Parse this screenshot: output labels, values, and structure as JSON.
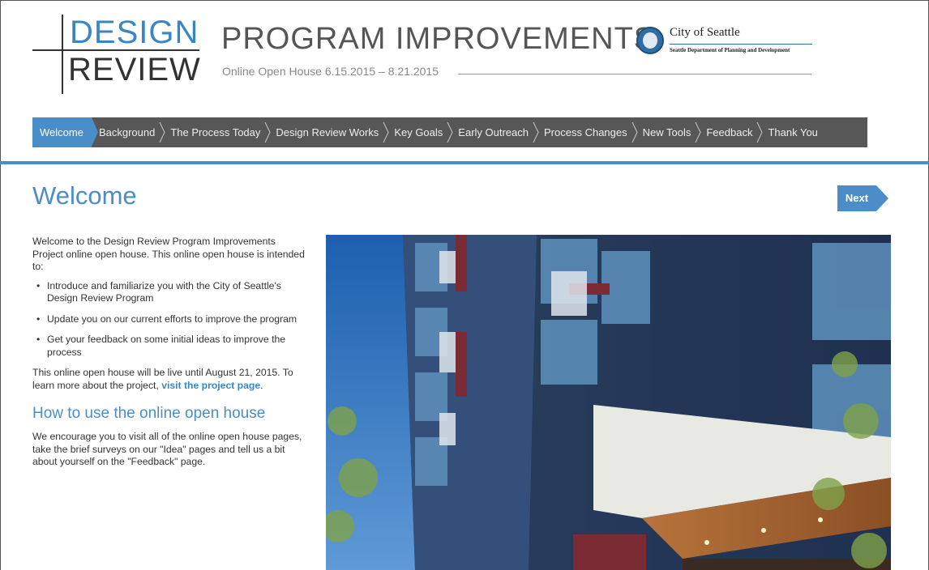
{
  "header": {
    "logo": {
      "line1": "DESIGN",
      "line2": "REVIEW"
    },
    "title": "PROGRAM IMPROVEMENTS",
    "subtitle": "Online Open House 6.15.2015 – 8.21.2015",
    "city": "City of Seattle",
    "department": "Seattle Department of Planning and Development"
  },
  "nav": {
    "items": [
      {
        "label": "Welcome",
        "active": true
      },
      {
        "label": "Background"
      },
      {
        "label": "The Process Today"
      },
      {
        "label": "Design Review Works"
      },
      {
        "label": "Key Goals"
      },
      {
        "label": "Early Outreach"
      },
      {
        "label": "Process Changes"
      },
      {
        "label": "New Tools"
      },
      {
        "label": "Feedback"
      },
      {
        "label": "Thank You"
      }
    ]
  },
  "main": {
    "title": "Welcome",
    "next_label": "Next",
    "intro": "Welcome to the Design Review Program Improvements Project online open house. This online open house is intended to:",
    "bullets": [
      "Introduce and familiarize you with the City of Seattle's Design Review Program",
      "Update you on our current efforts to improve the program",
      "Get your feedback on some initial ideas to improve the process"
    ],
    "live_text": "This online open house will be live until August 21, 2015. To learn more about the project, ",
    "project_link": "visit the project page",
    "live_end": ".",
    "howto_heading": "How to use the online open house",
    "howto_text": "We encourage you to visit all of the online open house pages, take the brief surveys on our \"Idea\" pages and tell us a bit about yourself on the \"Feedback\" page."
  },
  "colors": {
    "accent": "#4a8dc8",
    "nav_bg": "#575757"
  }
}
